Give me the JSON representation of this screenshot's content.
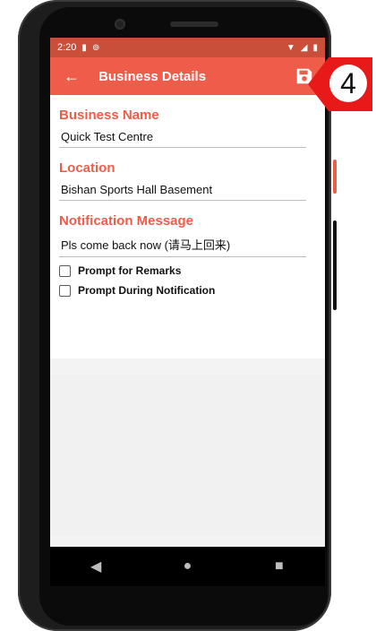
{
  "colors": {
    "accent": "#ef5d4a",
    "statusbar": "#c94f3b",
    "labels": "#ef5d4a",
    "callout": "#e71919"
  },
  "status": {
    "time": "2:20",
    "left_icons": [
      "sim-icon",
      "vpn-icon"
    ],
    "right_icons": [
      "wifi-icon",
      "signal-icon",
      "battery-icon"
    ]
  },
  "appbar": {
    "title": "Business Details",
    "back_icon": "arrow-left-icon",
    "save_icon": "save-icon"
  },
  "form": {
    "business_name_label": "Business Name",
    "business_name_value": "Quick Test Centre",
    "location_label": "Location",
    "location_value": "Bishan Sports Hall Basement",
    "notification_label": "Notification Message",
    "notification_value": "Pls come back now (请马上回来)",
    "checkboxes": [
      {
        "label": "Prompt for Remarks",
        "checked": false
      },
      {
        "label": "Prompt During Notification",
        "checked": false
      }
    ]
  },
  "callout": {
    "number": "4"
  }
}
